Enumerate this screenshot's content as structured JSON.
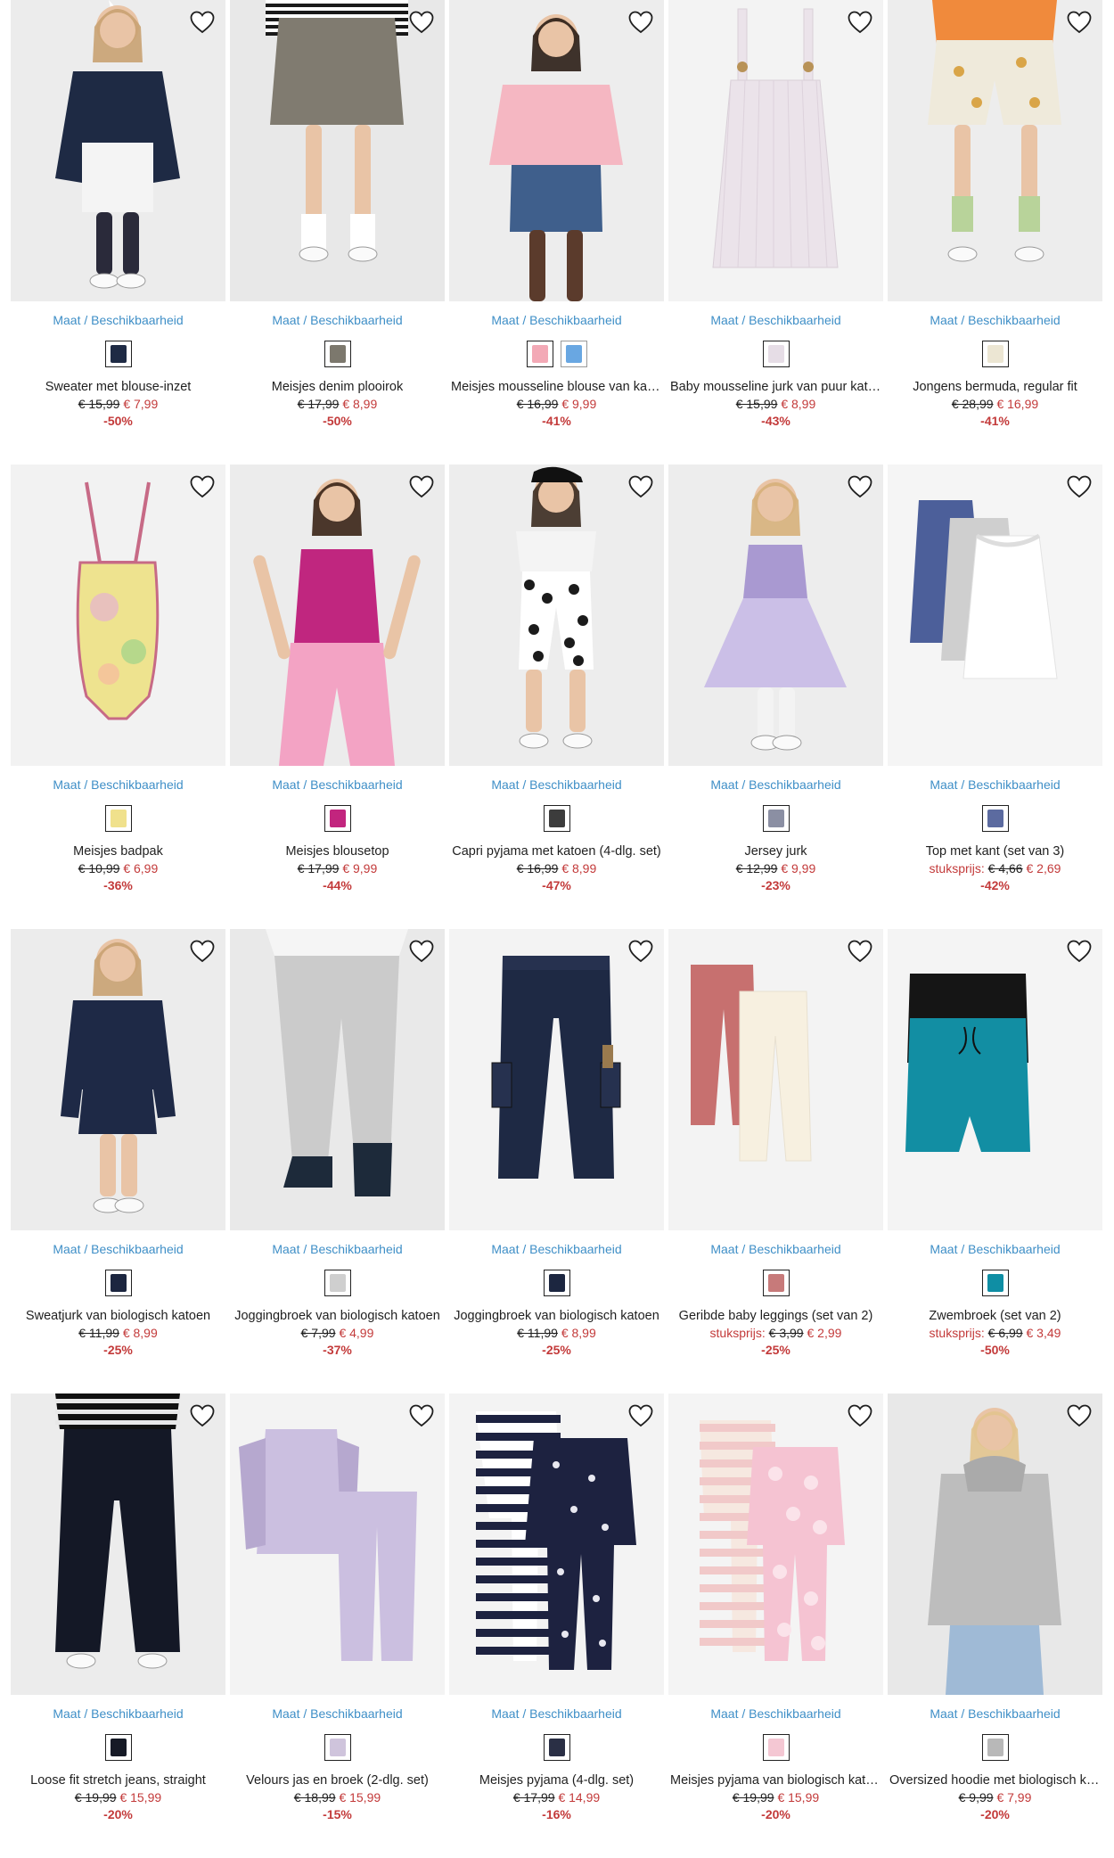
{
  "common": {
    "size_label": "Maat / Beschikbaarheid"
  },
  "colors": {
    "accent_link": "#3f8fc7",
    "sale_red": "#c33a3a",
    "photo_bg": "#eeeeee"
  },
  "products": [
    {
      "title": "Sweater met blouse-inzet",
      "prefix": "",
      "old": "€ 15,99",
      "new": "€ 7,99",
      "discount": "-50%",
      "swatches": [
        "#1e2a44"
      ],
      "art": "sweater",
      "c1": "#1e2a44",
      "c2": "#f4f4f4",
      "bg": "#ececec"
    },
    {
      "title": "Meisjes denim plooirok",
      "prefix": "",
      "old": "€ 17,99",
      "new": "€ 8,99",
      "discount": "-50%",
      "swatches": [
        "#7c786d"
      ],
      "art": "skirt",
      "c1": "#807b70",
      "c2": "#1a1a1a",
      "bg": "#e8e8e8"
    },
    {
      "title": "Meisjes mousseline blouse van katoen",
      "prefix": "",
      "old": "€ 16,99",
      "new": "€ 9,99",
      "discount": "-41%",
      "swatches": [
        "#f3a9b6",
        "#69a7e2"
      ],
      "art": "blouse",
      "c1": "#f5b7c2",
      "c2": "#3f5f8c",
      "bg": "#ededed"
    },
    {
      "title": "Baby mousseline jurk van puur katoen",
      "prefix": "",
      "old": "€ 15,99",
      "new": "€ 8,99",
      "discount": "-43%",
      "swatches": [
        "#e6dde6"
      ],
      "art": "babydress",
      "c1": "#ebe3ea",
      "c2": "#b89257",
      "bg": "#f3f3f3"
    },
    {
      "title": "Jongens bermuda, regular fit",
      "prefix": "",
      "old": "€ 28,99",
      "new": "€ 16,99",
      "discount": "-41%",
      "swatches": [
        "#ece6d3"
      ],
      "art": "shorts",
      "c1": "#efeadb",
      "c2": "#f08a3c",
      "bg": "#ededed"
    },
    {
      "title": "Meisjes badpak",
      "prefix": "",
      "old": "€ 10,99",
      "new": "€ 6,99",
      "discount": "-36%",
      "swatches": [
        "#f0e18c"
      ],
      "art": "swimsuit",
      "c1": "#eee38f",
      "c2": "#c76a86",
      "bg": "#f2f2f2"
    },
    {
      "title": "Meisjes blousetop",
      "prefix": "",
      "old": "€ 17,99",
      "new": "€ 9,99",
      "discount": "-44%",
      "swatches": [
        "#c2257e"
      ],
      "art": "tanktop",
      "c1": "#c0267f",
      "c2": "#f3a3c4",
      "bg": "#ececec"
    },
    {
      "title": "Capri pyjama met katoen (4-dlg. set)",
      "prefix": "",
      "old": "€ 16,99",
      "new": "€ 8,99",
      "discount": "-47%",
      "swatches": [
        "#3c3c3c"
      ],
      "art": "capri",
      "c1": "#f4f4f4",
      "c2": "#1b1b1b",
      "bg": "#ededed"
    },
    {
      "title": "Jersey jurk",
      "prefix": "",
      "old": "€ 12,99",
      "new": "€ 9,99",
      "discount": "-23%",
      "swatches": [
        "#8b8fa3"
      ],
      "art": "dress",
      "c1": "#a999d1",
      "c2": "#c7b9e6",
      "bg": "#ededed"
    },
    {
      "title": "Top met kant (set van 3)",
      "prefix": "stuksprijs: ",
      "old": "€ 4,66",
      "new": "€ 2,69",
      "discount": "-42%",
      "swatches": [
        "#5c6ba0"
      ],
      "art": "camis",
      "c1": "#4c5f9a",
      "c2": "#cfcfcf",
      "bg": "#f5f5f5"
    },
    {
      "title": "Sweatjurk van biologisch katoen",
      "prefix": "",
      "old": "€ 11,99",
      "new": "€ 8,99",
      "discount": "-25%",
      "swatches": [
        "#1c2640"
      ],
      "art": "sweatdress",
      "c1": "#1e2946",
      "c2": "#ffffff",
      "bg": "#ececec"
    },
    {
      "title": "Joggingbroek van biologisch katoen",
      "prefix": "",
      "old": "€ 7,99",
      "new": "€ 4,99",
      "discount": "-37%",
      "swatches": [
        "#cfcfcf"
      ],
      "art": "jogger",
      "c1": "#cbcbcb",
      "c2": "#1d2a3a",
      "bg": "#e9e9e9"
    },
    {
      "title": "Joggingbroek van biologisch katoen",
      "prefix": "",
      "old": "€ 11,99",
      "new": "€ 8,99",
      "discount": "-25%",
      "swatches": [
        "#1c2640"
      ],
      "art": "cargo",
      "c1": "#1e2944",
      "c2": "#9a7a4e",
      "bg": "#f3f3f3"
    },
    {
      "title": "Geribde baby leggings (set van 2)",
      "prefix": "stuksprijs: ",
      "old": "€ 3,99",
      "new": "€ 2,99",
      "discount": "-25%",
      "swatches": [
        "#c77a7a"
      ],
      "art": "leggings",
      "c1": "#c7706f",
      "c2": "#f7f0e0",
      "bg": "#f3f3f3"
    },
    {
      "title": "Zwembroek (set van 2)",
      "prefix": "stuksprijs: ",
      "old": "€ 6,99",
      "new": "€ 3,49",
      "discount": "-50%",
      "swatches": [
        "#0f8ea4"
      ],
      "art": "trunks",
      "c1": "#151515",
      "c2": "#128ea3",
      "bg": "#f4f4f4"
    },
    {
      "title": "Loose fit stretch jeans, straight",
      "prefix": "",
      "old": "€ 19,99",
      "new": "€ 15,99",
      "discount": "-20%",
      "swatches": [
        "#161a26"
      ],
      "art": "jeans",
      "c1": "#141826",
      "c2": "#e8e8e8",
      "bg": "#ececec"
    },
    {
      "title": "Velours jas en broek (2-dlg. set)",
      "prefix": "",
      "old": "€ 18,99",
      "new": "€ 15,99",
      "discount": "-15%",
      "swatches": [
        "#cfc4dc"
      ],
      "art": "velours",
      "c1": "#cbbfe0",
      "c2": "#b6a8cf",
      "bg": "#f3f3f3"
    },
    {
      "title": "Meisjes pyjama (4-dlg. set)",
      "prefix": "",
      "old": "€ 17,99",
      "new": "€ 14,99",
      "discount": "-16%",
      "swatches": [
        "#2a2f45"
      ],
      "art": "pyjama",
      "c1": "#1d2240",
      "c2": "#f2f2f2",
      "bg": "#f3f3f3"
    },
    {
      "title": "Meisjes pyjama van biologisch katoen",
      "prefix": "",
      "old": "€ 19,99",
      "new": "€ 15,99",
      "discount": "-20%",
      "swatches": [
        "#f4c7d3"
      ],
      "art": "pinkpj",
      "c1": "#f5c3d2",
      "c2": "#f6e8e0",
      "bg": "#f4f4f4"
    },
    {
      "title": "Oversized hoodie met biologisch katoen",
      "prefix": "",
      "old": "€ 9,99",
      "new": "€ 7,99",
      "discount": "-20%",
      "swatches": [
        "#b8b8b8"
      ],
      "art": "hoodie",
      "c1": "#bdbdbd",
      "c2": "#9fbad6",
      "bg": "#e8e8e8"
    }
  ]
}
